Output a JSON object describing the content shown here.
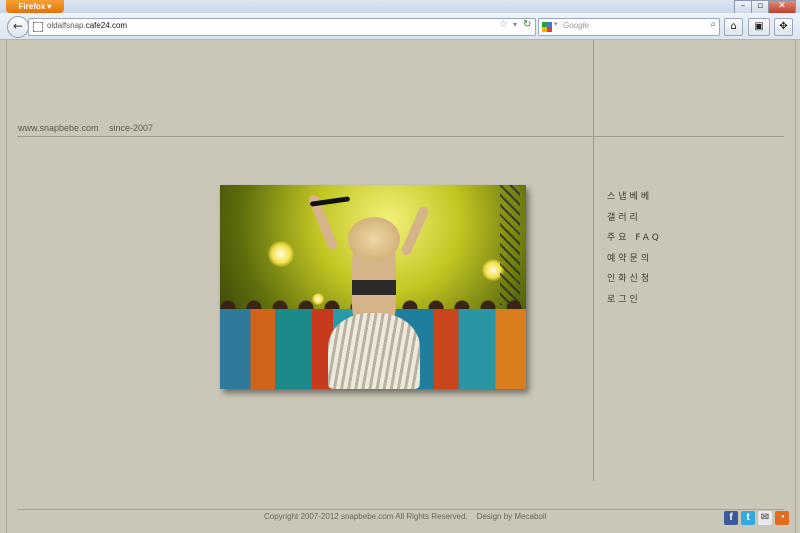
{
  "browser": {
    "app_button": "Firefox",
    "url_domain_prefix": "oldalfsnap.",
    "url_domain_main": "cafe24.com",
    "search_placeholder": "Google"
  },
  "site": {
    "url_text": "www.snapbebe.com",
    "since_text": "since-2007"
  },
  "menu": {
    "items": [
      "스냅베베",
      "갤러리",
      "주요 FAQ",
      "예약문의",
      "인화신청",
      "로그인"
    ]
  },
  "footer": {
    "copyright": "Copyright 2007-2012 snapbebe.com All Rights Reserved.",
    "design_credit": "Design by Mecaboil"
  },
  "icons": {
    "social": [
      "facebook-icon",
      "twitter-icon",
      "mail-icon",
      "rss-icon"
    ]
  },
  "colors": {
    "page_bg": "#cbc7b8",
    "rule": "#9e9a8c",
    "text": "#5b5850",
    "facebook": "#3b5998",
    "twitter": "#33a9dd",
    "rss": "#e36b1e"
  }
}
